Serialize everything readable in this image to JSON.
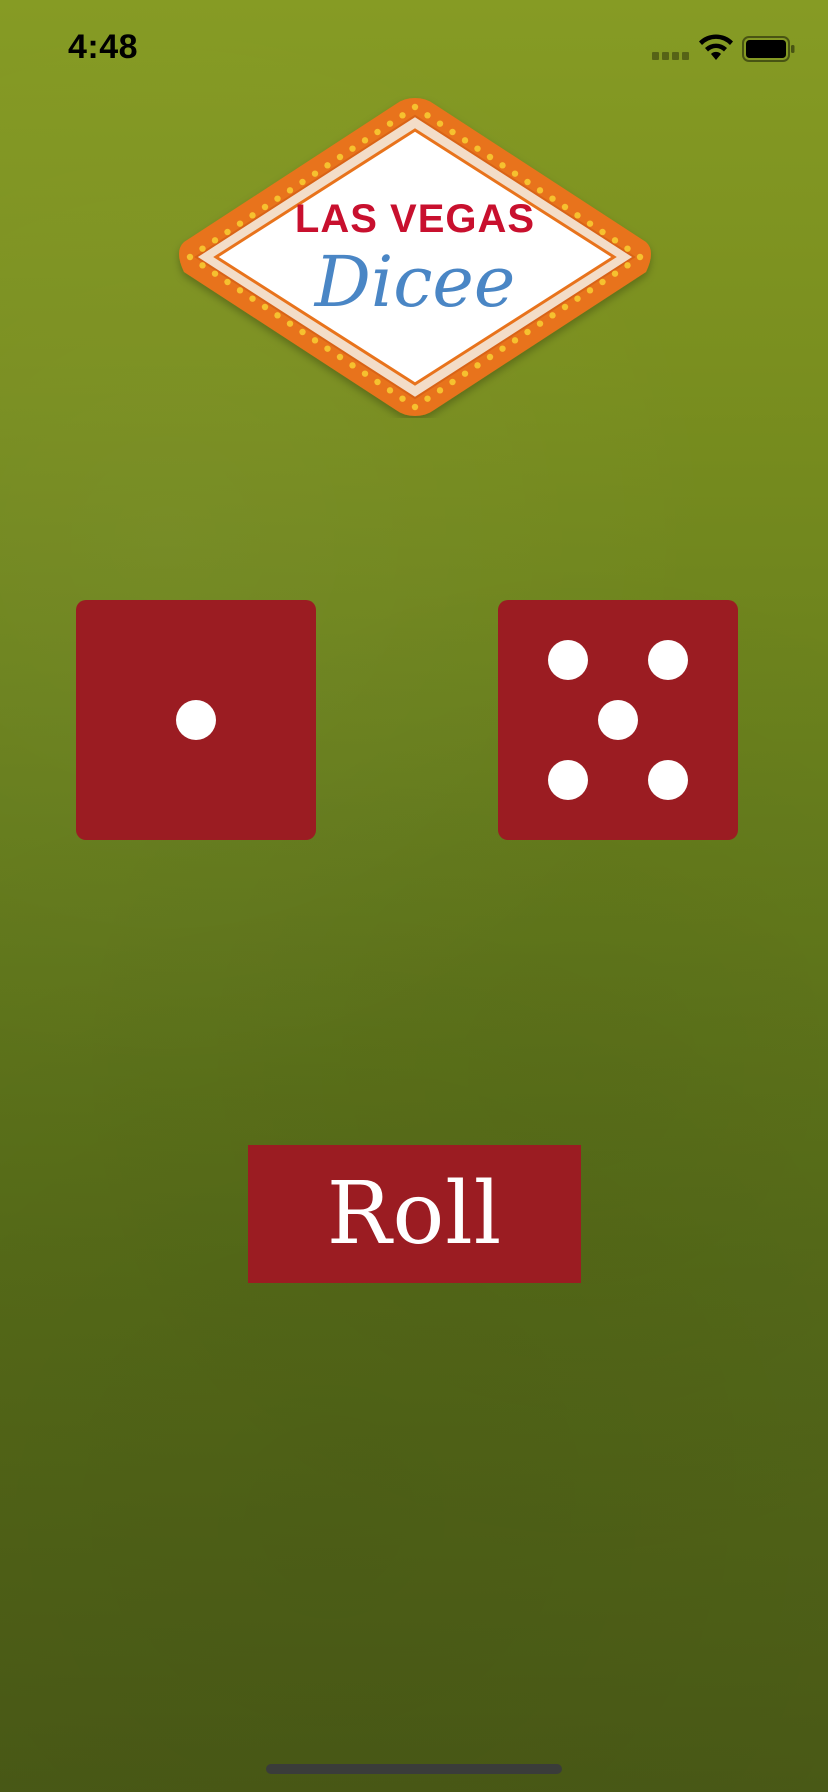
{
  "status_bar": {
    "time": "4:48",
    "icons": [
      "signal-icon",
      "wifi-icon",
      "battery-icon"
    ]
  },
  "logo": {
    "line1": "LAS VEGAS",
    "line2": "Dicee",
    "colors": {
      "frame_orange": "#e8731b",
      "bulb_yellow": "#f6c12f",
      "line1_red": "#c8102e",
      "line2_blue": "#4a86c5"
    }
  },
  "dice": {
    "left": {
      "value": 1
    },
    "right": {
      "value": 5
    },
    "color": "#9b1c22",
    "pip_color": "#ffffff"
  },
  "roll_button": {
    "label": "Roll",
    "color": "#9b1c22"
  },
  "background": {
    "felt_top": "#869b24",
    "felt_bottom": "#4a5a16"
  }
}
